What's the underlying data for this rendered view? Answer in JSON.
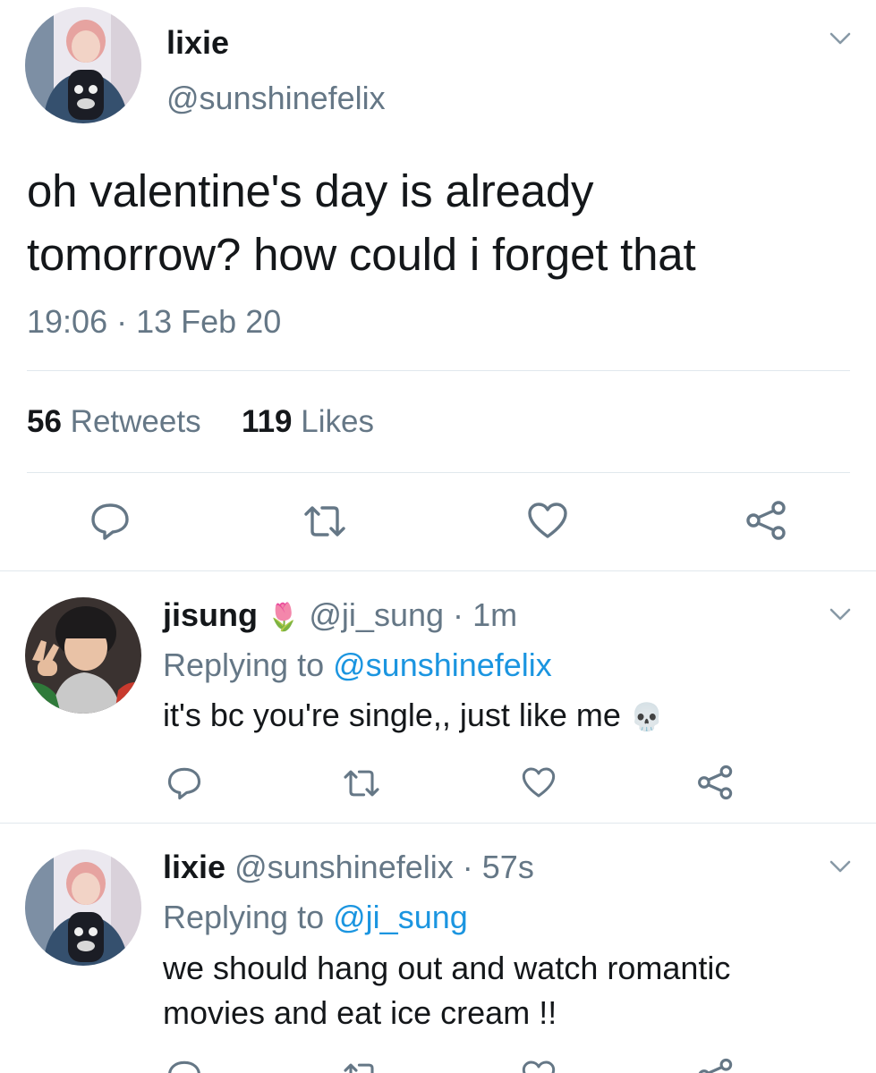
{
  "main_tweet": {
    "display_name": "lixie",
    "handle": "@sunshinefelix",
    "text_line1": "oh valentine's day is already",
    "text_line2": "tomorrow? how could i forget that",
    "time": "19:06",
    "separator": "·",
    "date": "13 Feb 20",
    "retweets_count": "56",
    "retweets_label": "Retweets",
    "likes_count": "119",
    "likes_label": "Likes"
  },
  "replies": [
    {
      "display_name": "jisung",
      "name_emoji": "🌷",
      "handle": "@ji_sung",
      "separator": "·",
      "time": "1m",
      "replying_prefix": "Replying to",
      "replying_handle": "@sunshinefelix",
      "text": "it's bc you're single,, just like me",
      "text_emoji": "💀"
    },
    {
      "display_name": "lixie",
      "handle": "@sunshinefelix",
      "separator": "·",
      "time": "57s",
      "replying_prefix": "Replying to",
      "replying_handle": "@ji_sung",
      "text_line1": "we should hang out and watch romantic",
      "text_line2": "movies and eat ice cream !!"
    }
  ],
  "icons": {
    "reply": "speech-bubble-icon",
    "retweet": "retweet-icon",
    "like": "heart-icon",
    "share": "share-icon",
    "menu": "chevron-down-icon"
  },
  "colors": {
    "text": "#14171a",
    "secondary": "#657786",
    "link": "#1b95e0",
    "divider": "#e1e8ed"
  }
}
